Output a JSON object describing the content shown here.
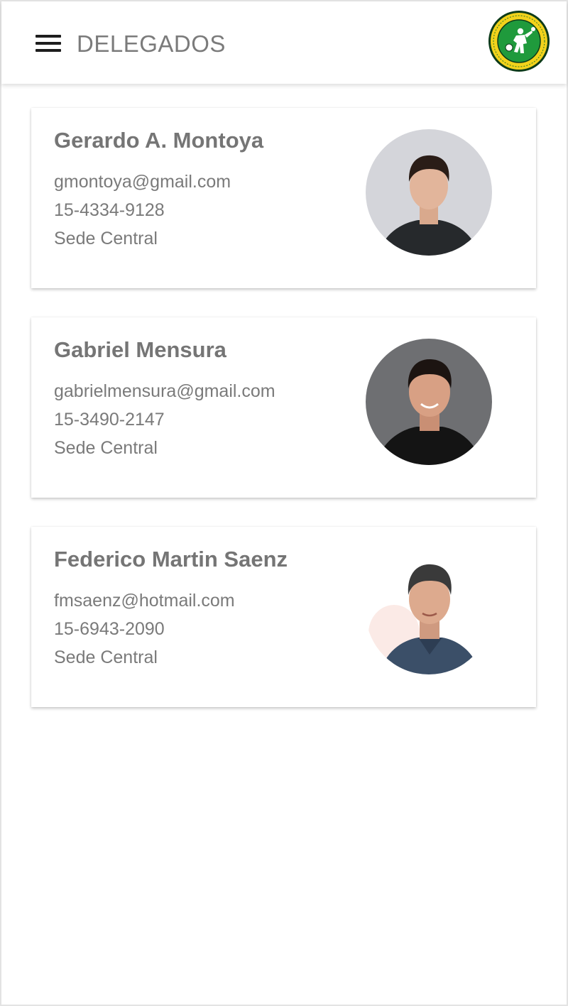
{
  "app_bar": {
    "title": "DELEGADOS",
    "menu_icon": "hamburger-menu-icon",
    "logo_icon": "club-crest-logo",
    "logo_colors": {
      "ring": "#f2d21b",
      "field": "#1f9a3c",
      "border": "#0d3b19"
    }
  },
  "delegates": [
    {
      "name": "Gerardo A. Montoya",
      "email": "gmontoya@gmail.com",
      "phone": "15-4334-9128",
      "location": "Sede Central",
      "photo": "avatar-photo-light-background"
    },
    {
      "name": "Gabriel Mensura",
      "email": "gabrielmensura@gmail.com",
      "phone": "15-3490-2147",
      "location": "Sede Central",
      "photo": "avatar-photo-gray-background"
    },
    {
      "name": "Federico Martin Saenz",
      "email": "fmsaenz@hotmail.com",
      "phone": "15-6943-2090",
      "location": "Sede Central",
      "photo": "avatar-photo-white-background"
    }
  ],
  "colors": {
    "text_primary": "#757575",
    "background": "#ffffff"
  }
}
